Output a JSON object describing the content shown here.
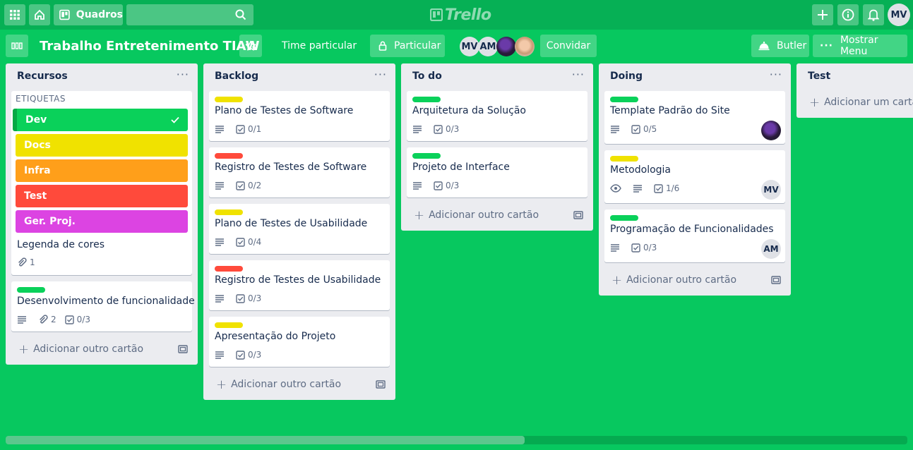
{
  "topbar": {
    "boards_label": "Quadros",
    "logo_text": "Trello",
    "user_initials": "MV"
  },
  "board": {
    "title": "Trabalho Entretenimento TIAW",
    "team_label": "Time particular",
    "visibility_label": "Particular",
    "members": [
      "MV",
      "AM"
    ],
    "invite_label": "Convidar",
    "butler_label": "Butler",
    "menu_label": "Mostrar Menu"
  },
  "colors": {
    "board_bg": "#07c85f",
    "green": "#0ad15a",
    "yellow": "#f0e200",
    "orange": "#ff9f1a",
    "red": "#ff4a3b",
    "purple": "#dc44e2"
  },
  "lists": [
    {
      "title": "Recursos",
      "labels_heading": "ETIQUETAS",
      "labels": [
        "Dev",
        "Docs",
        "Infra",
        "Test",
        "Ger. Proj."
      ],
      "cards": [
        {
          "title": "Legenda de cores",
          "attachments": "1"
        },
        {
          "title": "Desenvolvimento de funcionalidade",
          "attachments": "2",
          "checklist": "0/3"
        }
      ],
      "add_label": "Adicionar outro cartão"
    },
    {
      "title": "Backlog",
      "cards": [
        {
          "title": "Plano de Testes de Software",
          "checklist": "0/1"
        },
        {
          "title": "Registro de Testes de Software",
          "checklist": "0/2"
        },
        {
          "title": "Plano de Testes de Usabilidade",
          "checklist": "0/4"
        },
        {
          "title": "Registro de Testes de Usabilidade",
          "checklist": "0/3"
        },
        {
          "title": "Apresentação do Projeto",
          "checklist": "0/3"
        }
      ],
      "add_label": "Adicionar outro cartão"
    },
    {
      "title": "To do",
      "cards": [
        {
          "title": "Arquitetura da Solução",
          "checklist": "0/3"
        },
        {
          "title": "Projeto de Interface",
          "checklist": "0/3"
        }
      ],
      "add_label": "Adicionar outro cartão"
    },
    {
      "title": "Doing",
      "cards": [
        {
          "title": "Template Padrão do Site",
          "checklist": "0/5"
        },
        {
          "title": "Metodologia",
          "checklist": "1/6",
          "member": "MV"
        },
        {
          "title": "Programação de Funcionalidades",
          "checklist": "0/3",
          "member": "AM"
        }
      ],
      "add_label": "Adicionar outro cartão"
    },
    {
      "title": "Test",
      "add_label": "Adicionar um cartão"
    }
  ]
}
